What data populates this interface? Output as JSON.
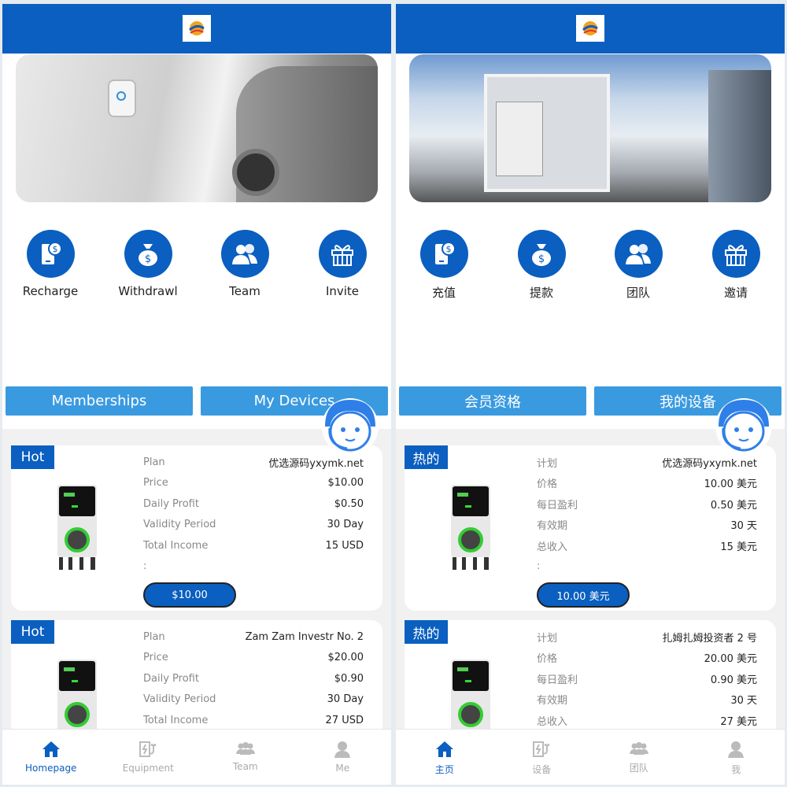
{
  "colors": {
    "primary": "#0a5fc0",
    "tab_button": "#3a9ae0",
    "inactive": "#aaaaaa"
  },
  "panels": [
    {
      "quick": [
        {
          "label": "Recharge",
          "icon": "phone-dollar-icon"
        },
        {
          "label": "Withdrawl",
          "icon": "money-bag-icon"
        },
        {
          "label": "Team",
          "icon": "team-icon"
        },
        {
          "label": "Invite",
          "icon": "gift-icon"
        }
      ],
      "tabs": [
        "Memberships",
        "My Devices"
      ],
      "cards": [
        {
          "badge": "Hot",
          "rows": [
            {
              "k": "Plan",
              "v": "优选源码yxymk.net"
            },
            {
              "k": "Price",
              "v": "$10.00"
            },
            {
              "k": "Daily Profit",
              "v": "$0.50"
            },
            {
              "k": "Validity Period",
              "v": "30 Day"
            },
            {
              "k": "Total Income",
              "v": "15 USD"
            },
            {
              "k": ":",
              "v": ""
            }
          ],
          "button": "$10.00"
        },
        {
          "badge": "Hot",
          "rows": [
            {
              "k": "Plan",
              "v": "Zam Zam Investr No. 2"
            },
            {
              "k": "Price",
              "v": "$20.00"
            },
            {
              "k": "Daily Profit",
              "v": "$0.90"
            },
            {
              "k": "Validity Period",
              "v": "30 Day"
            },
            {
              "k": "Total Income",
              "v": "27 USD"
            }
          ]
        }
      ],
      "nav": [
        {
          "label": "Homepage",
          "icon": "home-icon",
          "active": true
        },
        {
          "label": "Equipment",
          "icon": "charger-icon"
        },
        {
          "label": "Team",
          "icon": "team-icon"
        },
        {
          "label": "Me",
          "icon": "user-icon"
        }
      ]
    },
    {
      "quick": [
        {
          "label": "充值",
          "icon": "phone-dollar-icon"
        },
        {
          "label": "提款",
          "icon": "money-bag-icon"
        },
        {
          "label": "团队",
          "icon": "team-icon"
        },
        {
          "label": "邀请",
          "icon": "gift-icon"
        }
      ],
      "tabs": [
        "会员资格",
        "我的设备"
      ],
      "cards": [
        {
          "badge": "热的",
          "rows": [
            {
              "k": "计划",
              "v": "优选源码yxymk.net"
            },
            {
              "k": "价格",
              "v": "10.00 美元"
            },
            {
              "k": "每日盈利",
              "v": "0.50 美元"
            },
            {
              "k": "有效期",
              "v": "30 天"
            },
            {
              "k": "总收入",
              "v": "15 美元"
            },
            {
              "k": ":",
              "v": ""
            }
          ],
          "button": "10.00 美元"
        },
        {
          "badge": "热的",
          "rows": [
            {
              "k": "计划",
              "v": "扎姆扎姆投资者 2 号"
            },
            {
              "k": "价格",
              "v": "20.00 美元"
            },
            {
              "k": "每日盈利",
              "v": "0.90 美元"
            },
            {
              "k": "有效期",
              "v": "30 天"
            },
            {
              "k": "总收入",
              "v": "27 美元"
            }
          ]
        }
      ],
      "nav": [
        {
          "label": "主页",
          "icon": "home-icon",
          "active": true
        },
        {
          "label": "设备",
          "icon": "charger-icon"
        },
        {
          "label": "团队",
          "icon": "team-icon"
        },
        {
          "label": "我",
          "icon": "user-icon"
        }
      ]
    }
  ]
}
